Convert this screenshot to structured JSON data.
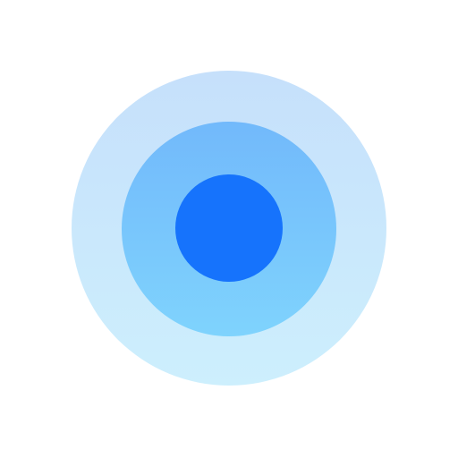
{
  "icon": {
    "name": "concentric-circles-icon",
    "colors": {
      "background": "#ffffff",
      "outer_top": "#c6e0fb",
      "outer_bottom": "#cdeffd",
      "middle_top": "#72b9fb",
      "middle_bottom": "#7fd3fd",
      "core": "#1673fc"
    }
  }
}
